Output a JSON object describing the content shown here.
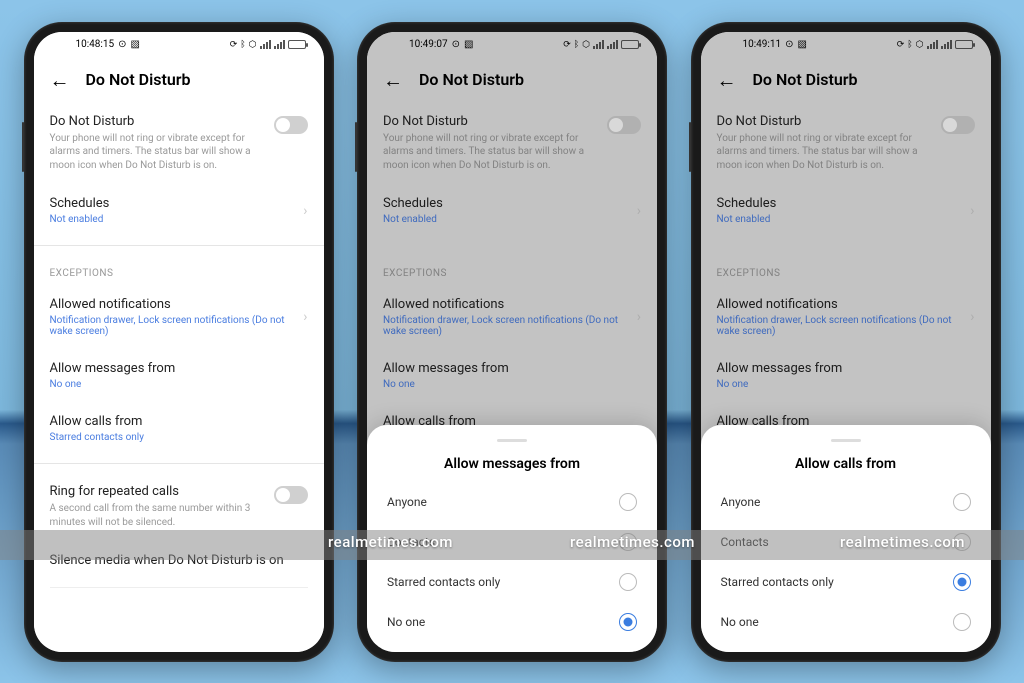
{
  "watermark": "realmetimes.com",
  "phones": [
    {
      "time": "10:48:15",
      "dimmed": false,
      "sheet": null
    },
    {
      "time": "10:49:07",
      "dimmed": true,
      "sheet": {
        "title": "Allow messages from",
        "selected": "No one"
      }
    },
    {
      "time": "10:49:11",
      "dimmed": true,
      "sheet": {
        "title": "Allow calls from",
        "selected": "Starred contacts only"
      }
    }
  ],
  "sheet_options": [
    "Anyone",
    "Contacts",
    "Starred contacts only",
    "No one"
  ],
  "screen": {
    "header_title": "Do Not Disturb",
    "dnd": {
      "title": "Do Not Disturb",
      "desc": "Your phone will not ring or vibrate except for alarms and timers. The status bar will show a moon icon when Do Not Disturb is on."
    },
    "schedules": {
      "title": "Schedules",
      "value": "Not enabled"
    },
    "section_exceptions": "EXCEPTIONS",
    "allowed_notif": {
      "title": "Allowed notifications",
      "value": "Notification drawer, Lock screen notifications (Do not wake screen)"
    },
    "allow_msg": {
      "title": "Allow messages from",
      "value": "No one"
    },
    "allow_calls": {
      "title": "Allow calls from",
      "value": "Starred contacts only"
    },
    "ring_repeated": {
      "title": "Ring for repeated calls",
      "desc": "A second call from the same number within 3 minutes will not be silenced."
    },
    "silence_media": {
      "title": "Silence media when Do Not Disturb is on"
    }
  }
}
